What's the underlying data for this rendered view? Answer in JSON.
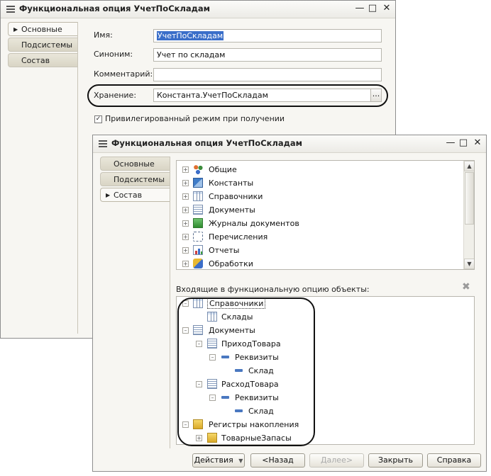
{
  "window1": {
    "title": "Функциональная опция УчетПоСкладам",
    "tabs": [
      "Основные",
      "Подсистемы",
      "Состав"
    ],
    "fields": {
      "name_label": "Имя:",
      "name_value": "УчетПоСкладам",
      "synonym_label": "Синоним:",
      "synonym_value": "Учет по складам",
      "comment_label": "Комментарий:",
      "comment_value": "",
      "storage_label": "Хранение:",
      "storage_value": "Константа.УчетПоСкладам",
      "storage_button": "..."
    },
    "privileged_checkbox": {
      "label": "Привилегированный режим при получении",
      "checked": true
    }
  },
  "window2": {
    "title": "Функциональная опция УчетПоСкладам",
    "tabs": [
      "Основные",
      "Подсистемы",
      "Состав"
    ],
    "object_tree": [
      {
        "label": "Общие",
        "icon": "general-icon"
      },
      {
        "label": "Константы",
        "icon": "constants-icon"
      },
      {
        "label": "Справочники",
        "icon": "catalog-icon"
      },
      {
        "label": "Документы",
        "icon": "document-icon"
      },
      {
        "label": "Журналы документов",
        "icon": "journal-icon"
      },
      {
        "label": "Перечисления",
        "icon": "enum-icon"
      },
      {
        "label": "Отчеты",
        "icon": "report-icon"
      },
      {
        "label": "Обработки",
        "icon": "processing-icon"
      }
    ],
    "included_label": "Входящие в функциональную опцию объекты:",
    "included_tree": [
      "Справочники",
      "Склады",
      "Документы",
      "ПриходТовара",
      "Реквизиты",
      "Склад",
      "РасходТовара",
      "Реквизиты",
      "Склад",
      "Регистры накопления",
      "ТоварныеЗапасы"
    ],
    "buttons": {
      "actions": "Действия",
      "back": "<Назад",
      "next": "Далее>",
      "close": "Закрыть",
      "help": "Справка"
    }
  }
}
